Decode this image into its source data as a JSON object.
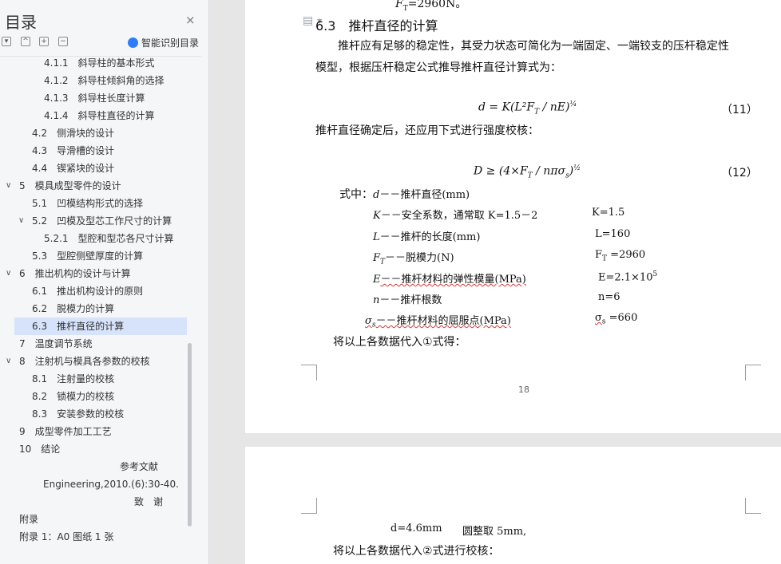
{
  "sidebar": {
    "title": "目录",
    "close_icon": "×",
    "controls": [
      "▾",
      "^",
      "+",
      "−"
    ],
    "smart_label": "智能识别目录",
    "toc": [
      {
        "text": "4.1.1　斜导柱的基本形式",
        "level": 3
      },
      {
        "text": "4.1.2　斜导柱倾斜角的选择",
        "level": 3
      },
      {
        "text": "4.1.3　斜导柱长度计算",
        "level": 3
      },
      {
        "text": "4.1.4　斜导柱直径的计算",
        "level": 3
      },
      {
        "text": "4.2　侧滑块的设计",
        "level": 2
      },
      {
        "text": "4.3　导滑槽的设计",
        "level": 2
      },
      {
        "text": "4.4　锲紧块的设计",
        "level": 2
      },
      {
        "text": "5　模具成型零件的设计",
        "level": 1,
        "expanded": true
      },
      {
        "text": "5.1　凹模结构形式的选择",
        "level": 2
      },
      {
        "text": "5.2　凹模及型芯工作尺寸的计算",
        "level": 2,
        "expanded": true
      },
      {
        "text": "5.2.1　型腔和型芯各尺寸计算",
        "level": 3
      },
      {
        "text": "5.3　型腔侧壁厚度的计算",
        "level": 2
      },
      {
        "text": "6　推出机构的设计与计算",
        "level": 1,
        "expanded": true
      },
      {
        "text": "6.1　推出机构设计的原则",
        "level": 2
      },
      {
        "text": "6.2　脱模力的计算",
        "level": 2
      },
      {
        "text": "6.3　推杆直径的计算",
        "level": 2,
        "selected": true
      },
      {
        "text": "7　温度调节系统",
        "level": 1
      },
      {
        "text": "8　注射机与模具各参数的校核",
        "level": 1,
        "expanded": true
      },
      {
        "text": "8.1　注射量的校核",
        "level": 2
      },
      {
        "text": "8.2　锁模力的校核",
        "level": 2
      },
      {
        "text": "8.3　安装参数的校核",
        "level": 2
      },
      {
        "text": "9　成型零件加工工艺",
        "level": 1
      },
      {
        "text": "10　结论",
        "level": 1
      },
      {
        "text": "参考文献",
        "level": 0,
        "align": "center"
      },
      {
        "text": "Engineering,2010.(6):30-40.",
        "level": 0,
        "align": "ref"
      },
      {
        "text": "致　谢",
        "level": 0,
        "align": "thanks"
      },
      {
        "text": "附录",
        "level": 0,
        "align": "left"
      },
      {
        "text": "附录 1：A0 图纸 1 张",
        "level": 0,
        "align": "left"
      }
    ]
  },
  "document": {
    "top_fragment": "F",
    "top_fragment_sub": "T",
    "top_fragment_rest": "=2960N。",
    "heading": "6.3　推杆直径的计算",
    "para1_line1": "推杆应有足够的稳定性，其受力状态可简化为一端固定、一端铰支的压杆稳定性",
    "para1_line2": "模型，根据压杆稳定公式推导推杆直径计算式为：",
    "eq11": "d = K(L²F",
    "eq11_sub": "T",
    "eq11_rest": " / nE)",
    "eq11_exp": "¼",
    "eq11_num": "（11）",
    "para2": "推杆直径确定后，还应用下式进行强度校核：",
    "eq12": "D ≥ (4×F",
    "eq12_sub": "T",
    "eq12_rest": " / nπσ",
    "eq12_sub2": "s",
    "eq12_close": ")",
    "eq12_exp": "½",
    "eq12_num": "（12）",
    "where_label": "式中：",
    "vars": [
      {
        "sym": "d",
        "desc": "－－推杆直径(mm)",
        "value": ""
      },
      {
        "sym": "K",
        "desc": "－－安全系数，通常取 K=1.5－2",
        "value": "K=1.5"
      },
      {
        "sym": "L",
        "desc": "－－推杆的长度(mm)",
        "value": "L=160"
      },
      {
        "sym": "F",
        "sub": "T",
        "desc": "－－脱模力(N)",
        "value": "F",
        "value_sub": "T",
        "value_rest": " =2960"
      },
      {
        "sym": "E",
        "desc": "－－推杆材料的弹性模量(MPa)",
        "value": "E=2.1×10",
        "value_sup": "5"
      },
      {
        "sym": "n",
        "desc": "－－推杆根数",
        "value": "n=6"
      },
      {
        "sym": "σ",
        "sub": "s",
        "desc": "－－推杆材料的屈服点(MPa)",
        "value": "σ",
        "value_sub": "s",
        "value_rest": " =660"
      }
    ],
    "conclude": "将以上各数据代入①式得：",
    "page_number": "18",
    "p2_line1_a": "d=4.6mm",
    "p2_line1_b": "圆整取 5mm,",
    "p2_line2": "将以上各数据代入②式进行校核："
  }
}
